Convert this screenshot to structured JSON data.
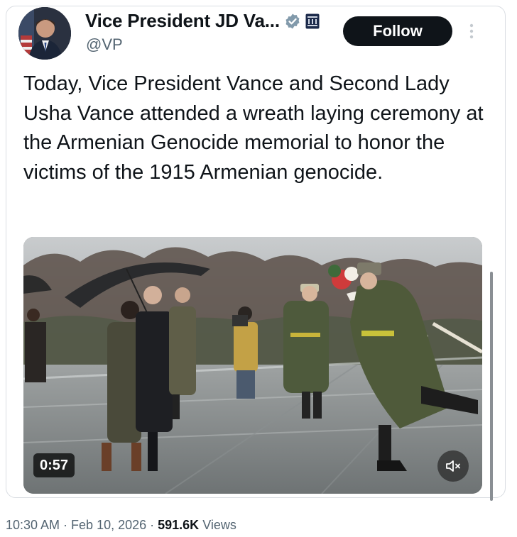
{
  "tweet": {
    "author_name": "Vice President JD Va...",
    "handle": "@VP",
    "follow_label": "Follow",
    "text": "Today, Vice President Vance and Second Lady Usha Vance attended a wreath laying ceremony at the Armenian Genocide memorial to honor the victims of the 1915 Armenian genocide.",
    "video": {
      "duration": "0:57"
    },
    "timestamp": "10:30 AM · Feb 10, 2026 · ",
    "views_count": "591.6K",
    "views_label": " Views"
  },
  "icons": {
    "verified": "verified-badge-icon",
    "affiliate": "government-affiliate-icon",
    "more": "more-options-icon",
    "mute": "muted-speaker-icon"
  },
  "colors": {
    "follow_bg": "#0f1419",
    "verified_badge": "#829aab",
    "secondary_text": "#536471"
  }
}
